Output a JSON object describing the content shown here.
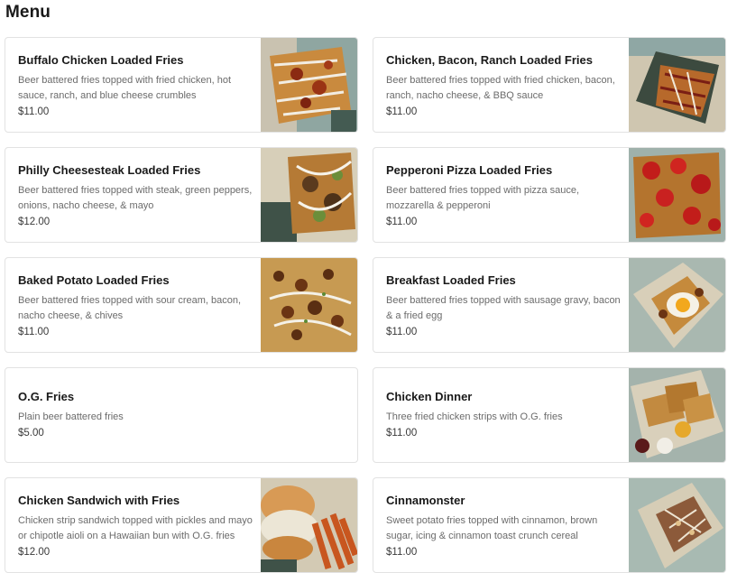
{
  "page": {
    "title": "Menu"
  },
  "items": [
    {
      "name": "Buffalo Chicken Loaded Fries",
      "description": "Beer battered fries topped with fried chicken, hot sauce, ranch, and blue cheese crumbles",
      "price": "$11.00",
      "photo": "buffalo-chicken-fries-photo"
    },
    {
      "name": "Chicken, Bacon, Ranch Loaded Fries",
      "description": "Beer battered fries topped with fried chicken, bacon, ranch, nacho cheese, & BBQ sauce",
      "price": "$11.00",
      "photo": "chicken-bacon-ranch-fries-photo"
    },
    {
      "name": "Philly Cheesesteak Loaded Fries",
      "description": "Beer battered fries topped with steak, green peppers, onions, nacho cheese, & mayo",
      "price": "$12.00",
      "photo": "philly-cheesesteak-fries-photo"
    },
    {
      "name": "Pepperoni Pizza Loaded Fries",
      "description": "Beer battered fries topped with pizza sauce, mozzarella & pepperoni",
      "price": "$11.00",
      "photo": "pepperoni-pizza-fries-photo"
    },
    {
      "name": "Baked Potato Loaded Fries",
      "description": "Beer battered fries topped with sour cream, bacon, nacho cheese, & chives",
      "price": "$11.00",
      "photo": "baked-potato-fries-photo"
    },
    {
      "name": "Breakfast Loaded Fries",
      "description": "Beer battered fries topped with sausage gravy, bacon & a fried egg",
      "price": "$11.00",
      "photo": "breakfast-fries-photo"
    },
    {
      "name": "O.G. Fries",
      "description": "Plain beer battered fries",
      "price": "$5.00",
      "photo": ""
    },
    {
      "name": "Chicken Dinner",
      "description": "Three fried chicken strips with O.G. fries",
      "price": "$11.00",
      "photo": "chicken-dinner-photo"
    },
    {
      "name": "Chicken Sandwich with Fries",
      "description": "Chicken strip sandwich topped with pickles and mayo or chipotle aioli on a Hawaiian bun with O.G. fries",
      "price": "$12.00",
      "photo": "chicken-sandwich-photo"
    },
    {
      "name": "Cinnamonster",
      "description": "Sweet potato fries topped with cinnamon, brown sugar, icing & cinnamon toast crunch cereal",
      "price": "$11.00",
      "photo": "cinnamonster-photo"
    }
  ]
}
